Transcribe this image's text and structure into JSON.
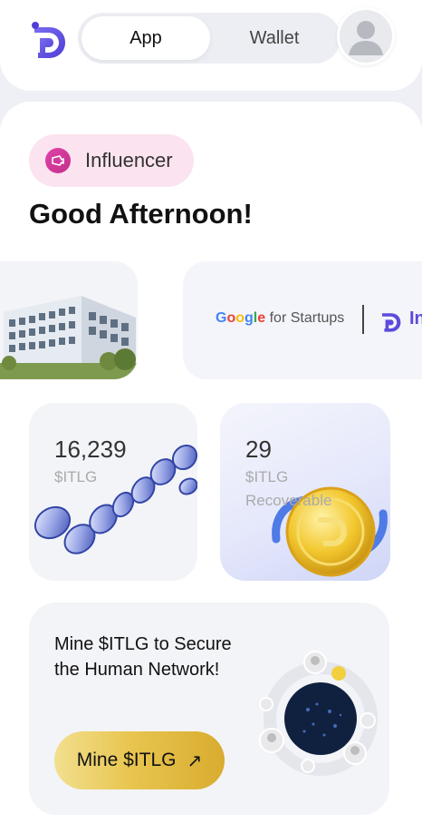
{
  "header": {
    "tabs": [
      {
        "label": "App",
        "active": true
      },
      {
        "label": "Wallet",
        "active": false
      }
    ],
    "icons": {
      "logo": "itlg-logo-icon",
      "avatar": "user-avatar-icon"
    }
  },
  "profile": {
    "badge_label": "Influencer",
    "greeting": "Good Afternoon!"
  },
  "banners": {
    "partner_google": "Google",
    "partner_suffix": " for Startups",
    "partner_cut": "In"
  },
  "stats": [
    {
      "value": "16,239",
      "unit": "$ITLG",
      "sub": ""
    },
    {
      "value": "29",
      "unit": "$ITLG",
      "sub": "Recoverable"
    }
  ],
  "mine": {
    "title": "Mine $ITLG to Secure the Human Network!",
    "button_label": "Mine $ITLG"
  },
  "colors": {
    "accent_purple": "#5c4bdc",
    "badge_bg": "#fbe3ef",
    "badge_icon": "#d53a9b",
    "gold": "#e8c54f",
    "google_blue": "#4285F4",
    "google_red": "#EA4335",
    "google_yellow": "#FBBC05",
    "google_green": "#34A853"
  }
}
